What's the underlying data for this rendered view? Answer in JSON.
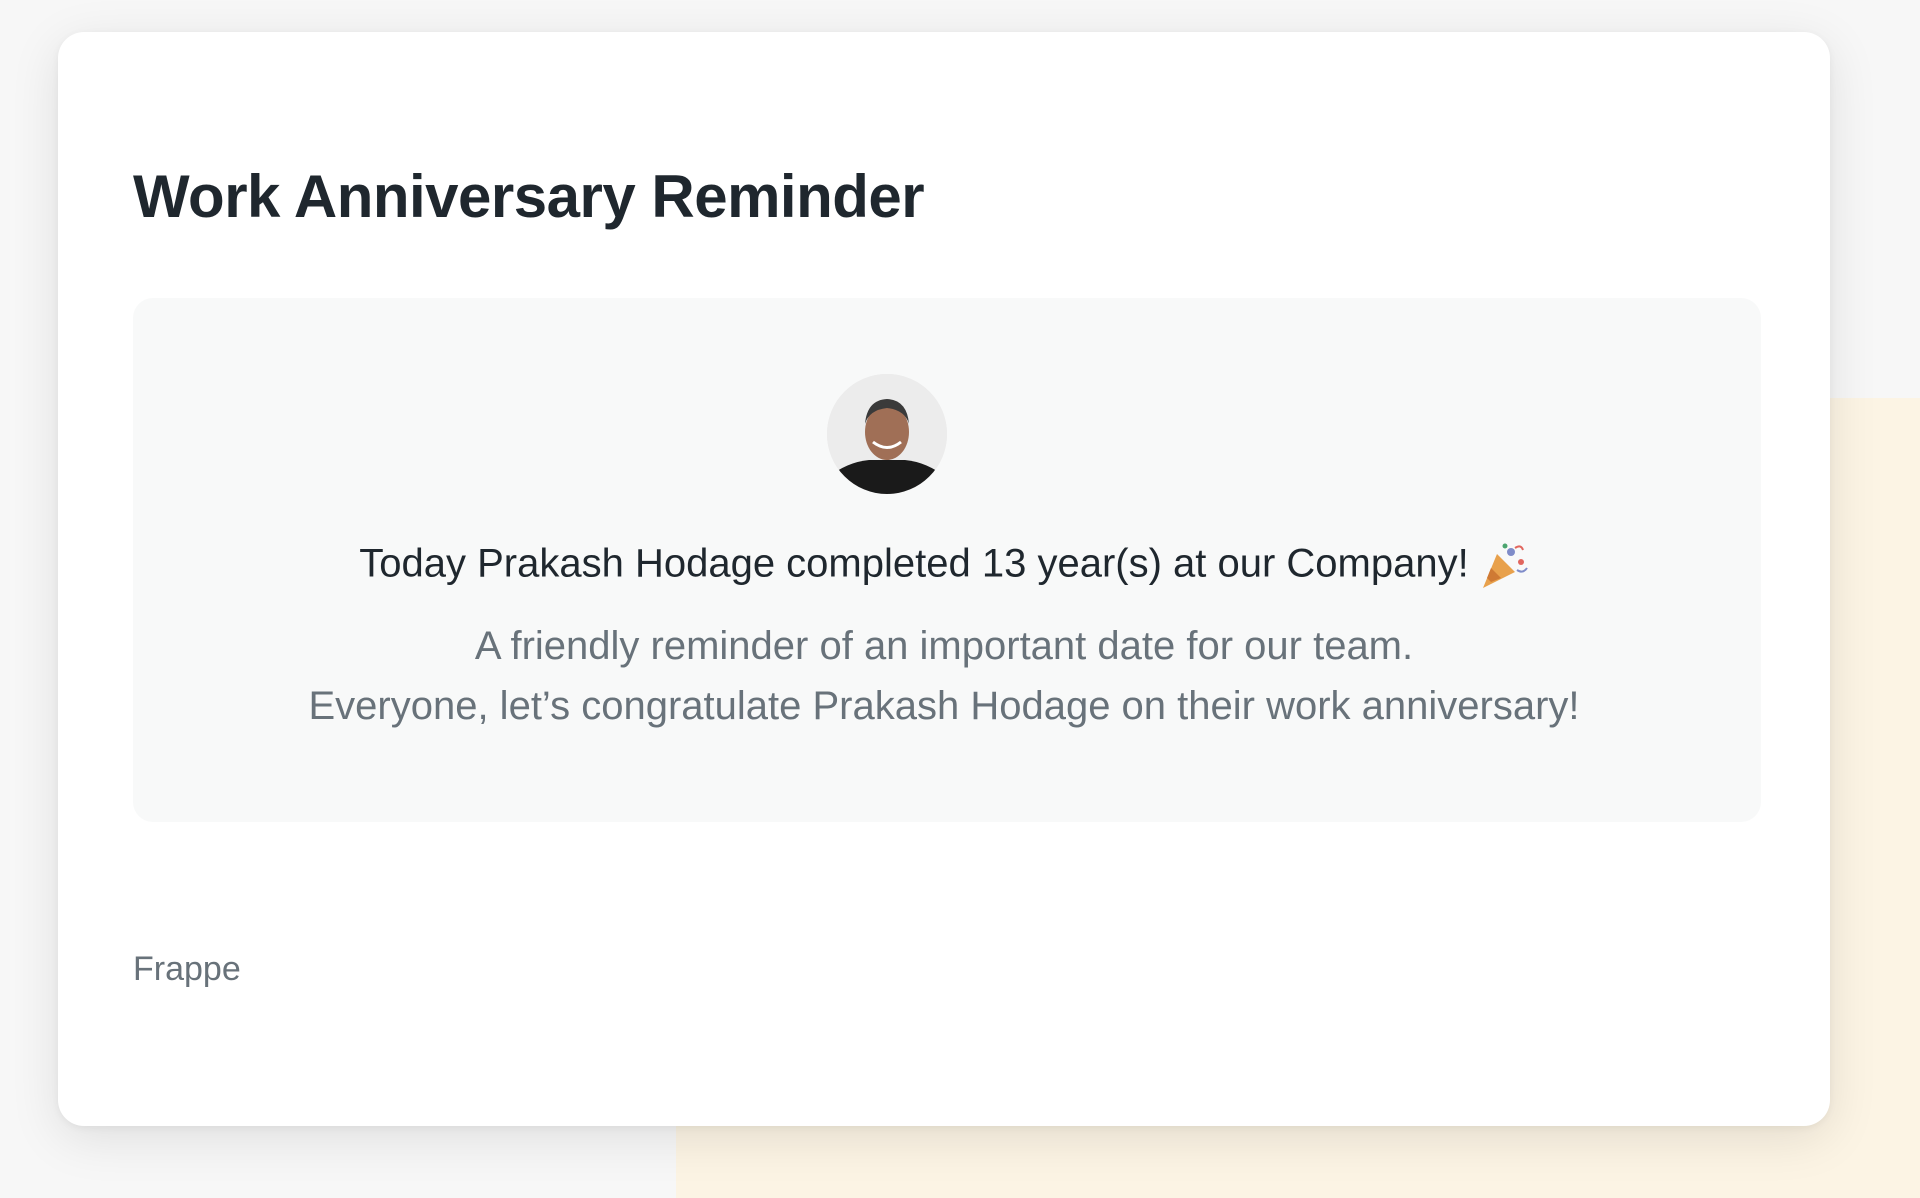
{
  "email": {
    "title": "Work Anniversary Reminder",
    "message": "Today Prakash Hodage completed 13 year(s) at our Company!",
    "party_icon": "party-popper-icon",
    "sub_line_1": "A friendly reminder of an important date for our team.",
    "sub_line_2": "Everyone, let’s congratulate Prakash Hodage on their work anniversary!",
    "footer": "Frappe"
  },
  "colors": {
    "title": "#1f272e",
    "muted": "#68727a",
    "panel": "#f8f9f9",
    "accent_bg": "#fcf4e4"
  }
}
